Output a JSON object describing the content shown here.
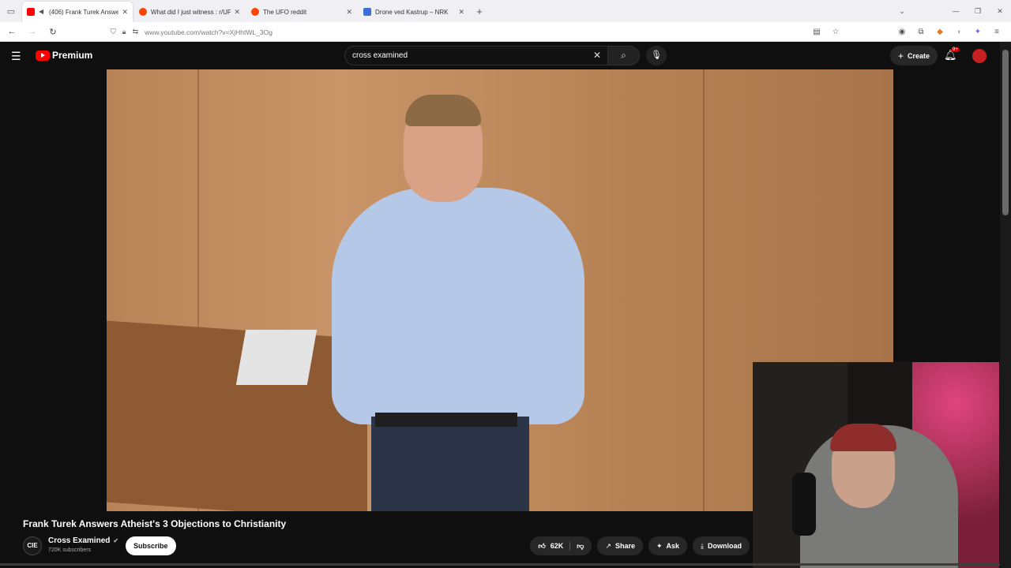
{
  "browser": {
    "tabs": [
      {
        "title": "(406) Frank Turek Answers A",
        "favicon_color": "#ff0000",
        "active": true
      },
      {
        "title": "What did I just witness : r/UFOs",
        "favicon_color": "#ff4500",
        "active": false
      },
      {
        "title": "The UFO reddit",
        "favicon_color": "#ff4500",
        "active": false
      },
      {
        "title": "Drone ved Kastrup – NRK",
        "favicon_color": "#3b6fd8",
        "active": false
      }
    ],
    "url": "www.youtube.com/watch?v=XjHhtWL_3Og"
  },
  "youtube": {
    "logo_text": "Premium",
    "search_value": "cross examined",
    "create_label": "Create",
    "notification_badge": "9+",
    "video_title": "Frank Turek Answers Atheist's 3 Objections to Christianity",
    "channel": {
      "avatar_text": "CIE",
      "name": "Cross Examined",
      "subscribers": "720K subscribers",
      "subscribe_label": "Subscribe"
    },
    "actions": {
      "likes": "62K",
      "share": "Share",
      "ask": "Ask",
      "download": "Download"
    },
    "brand_color": "#ff0000"
  }
}
